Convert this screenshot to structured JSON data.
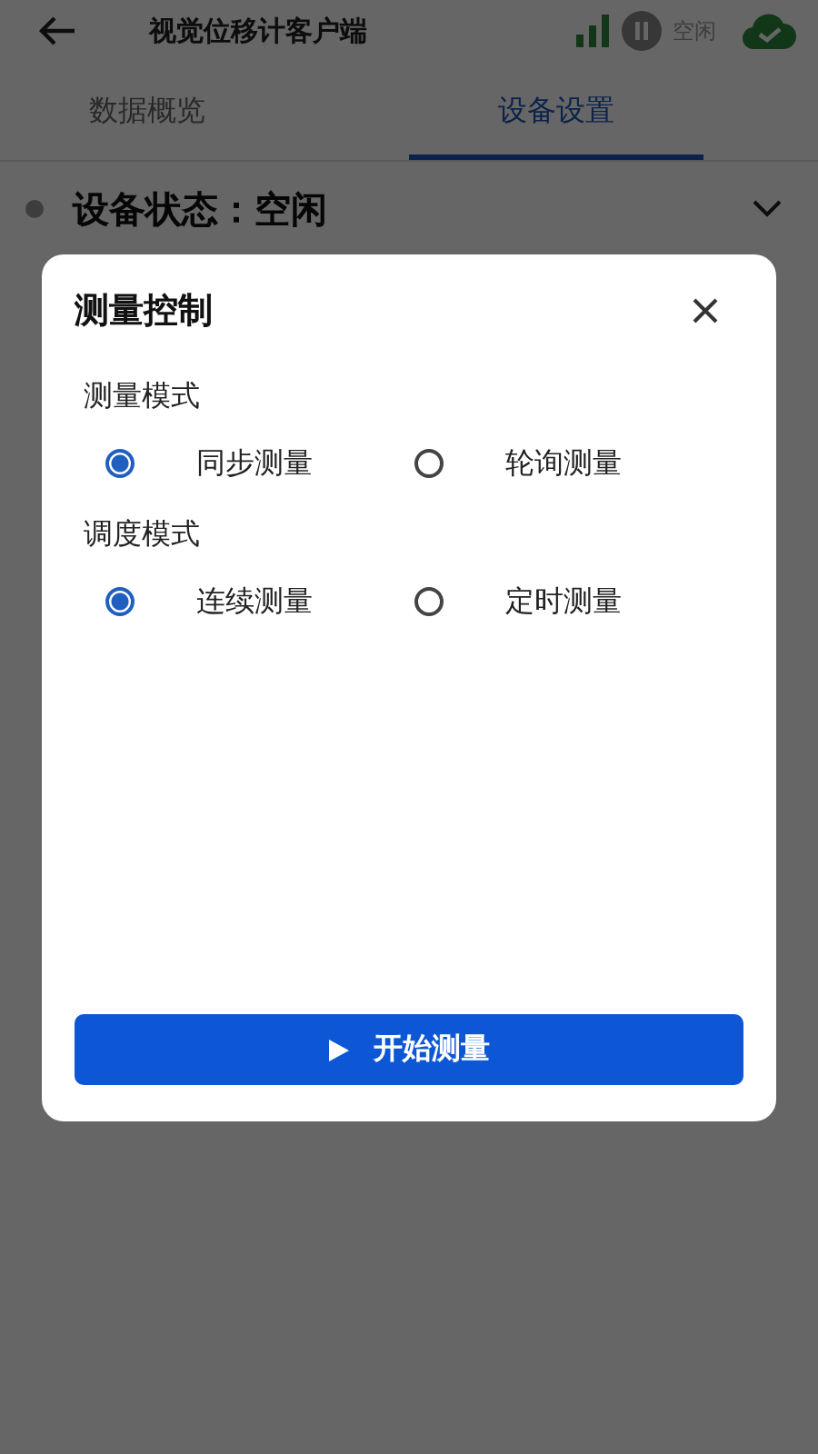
{
  "header": {
    "title": "视觉位移计客户端",
    "status_text": "空闲"
  },
  "tabs": [
    {
      "label": "数据概览",
      "selected": false
    },
    {
      "label": "设备设置",
      "selected": true
    }
  ],
  "device_status": {
    "label": "设备状态：空闲",
    "expanded": false
  },
  "dialog": {
    "title": "测量控制",
    "groups": [
      {
        "label": "测量模式",
        "options": [
          {
            "label": "同步测量",
            "selected": true
          },
          {
            "label": "轮询测量",
            "selected": false
          }
        ]
      },
      {
        "label": "调度模式",
        "options": [
          {
            "label": "连续测量",
            "selected": true
          },
          {
            "label": "定时测量",
            "selected": false
          }
        ]
      }
    ],
    "button": {
      "label": "开始测量"
    }
  }
}
